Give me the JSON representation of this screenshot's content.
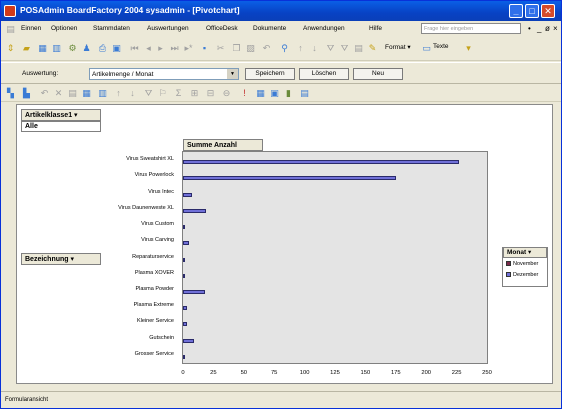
{
  "window": {
    "title": "POSAdmin BoardFactory 2004 sysadmin - [Pivotchart]",
    "minimize": "_",
    "maximize": "□",
    "close": "✕"
  },
  "menu": {
    "items": [
      "Einnen",
      "Optionen",
      "Stammdaten",
      "Auswertungen",
      "OfficeDesk",
      "Dokumente",
      "Anwendungen",
      "Hilfe"
    ],
    "help_placeholder": "Frage hier eingeben",
    "controls": [
      "•",
      "_",
      "ø",
      "×"
    ]
  },
  "toolbar": {
    "format_label": "Format ▾",
    "texte_label": "Texte"
  },
  "auswertung": {
    "label": "Auswertung:",
    "selected": "Artikelmenge / Monat",
    "save_label": "Speichern",
    "delete_label": "Löschen",
    "new_label": "Neu"
  },
  "pivot": {
    "page_field": "Artikelklasse1 ▾",
    "page_value": "Alle",
    "data_field": "Summe Anzahl",
    "row_field": "Bezeichnung ▾",
    "legend_field": "Monat ▾"
  },
  "colors": {
    "november": "#7a2a4a",
    "dezember": "#7070d8"
  },
  "chart_data": {
    "type": "bar",
    "orientation": "horizontal",
    "categories": [
      "Virus Sweatshirt XL",
      "Virus Powerlock",
      "Virus Intec",
      "Virus Daunenweste XL",
      "Virus Custom",
      "Virus Carving",
      "Reparaturservice",
      "Plasma XOVER",
      "Plasma Powder",
      "Plasma Extreme",
      "Kleiner Service",
      "Gutschein",
      "Grosser Service"
    ],
    "series": [
      {
        "name": "November",
        "values": [
          0,
          0,
          0,
          0,
          0,
          0,
          0,
          0,
          0,
          0,
          0,
          0,
          0
        ]
      },
      {
        "name": "Dezember",
        "values": [
          227,
          175,
          7,
          19,
          1,
          5,
          1,
          1,
          18,
          3,
          3,
          9,
          1
        ]
      }
    ],
    "xlim": [
      0,
      250
    ],
    "xticks": [
      "0",
      "25",
      "50",
      "75",
      "100",
      "125",
      "150",
      "175",
      "200",
      "225",
      "250"
    ],
    "grid": false,
    "legend": "right"
  },
  "status": {
    "text": "Formularansicht"
  }
}
